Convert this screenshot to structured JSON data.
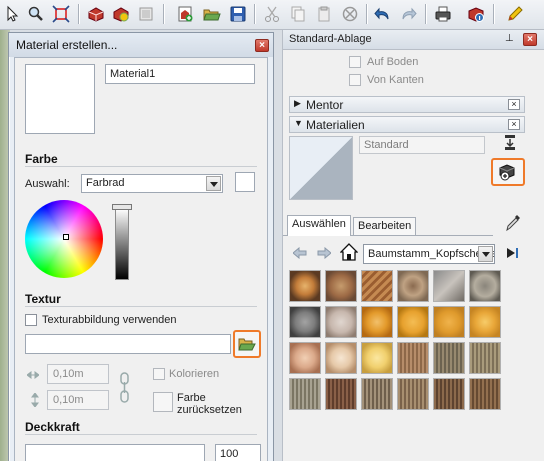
{
  "toolbar": {
    "icons": [
      "select-icon",
      "zoom-icon",
      "zoom-extents-icon",
      "components-icon",
      "component-options-icon",
      "preview-icon",
      "add-location-icon",
      "open-folder-icon",
      "save-icon",
      "cut-icon",
      "copy-icon",
      "paste-icon",
      "erase-icon",
      "undo-icon",
      "redo-icon",
      "print-icon",
      "model-info-icon",
      "pencil-icon"
    ]
  },
  "dialog": {
    "title": "Material erstellen...",
    "material_name": "Material1",
    "color_section": "Farbe",
    "picker_label": "Auswahl:",
    "picker_value": "Farbrad",
    "texture_section": "Textur",
    "use_texture_label": "Texturabbildung verwenden",
    "width_value": "0,10m",
    "height_value": "0,10m",
    "colorize_label": "Kolorieren",
    "reset_color_line1": "Farbe",
    "reset_color_line2": "zurücksetzen",
    "opacity_section": "Deckkraft",
    "opacity_value": "100"
  },
  "tray": {
    "title": "Standard-Ablage",
    "pin_glyph": "⊥",
    "on_ground_label": "Auf Boden",
    "from_edges_label": "Von Kanten",
    "panels": [
      {
        "label": "Mentor",
        "expanded": false
      },
      {
        "label": "Materialien",
        "expanded": true
      }
    ],
    "material_name": "Standard",
    "tabs": [
      "Auswählen",
      "Bearbeiten"
    ],
    "library": "Baumstamm_Kopfscheiben",
    "thumbnail_count": 24
  },
  "colors": {
    "highlight": "#ef7a2a"
  }
}
